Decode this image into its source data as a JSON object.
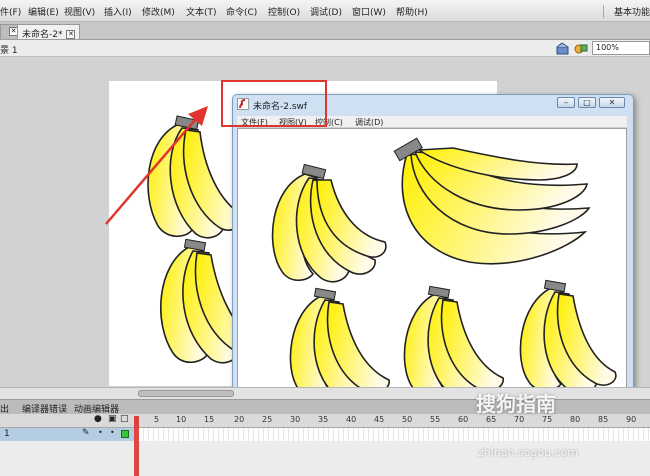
{
  "menu": {
    "items": [
      "件(F)",
      "编辑(E)",
      "视图(V)",
      "插入(I)",
      "修改(M)",
      "文本(T)",
      "命令(C)",
      "控制(O)",
      "调试(D)",
      "窗口(W)",
      "帮助(H)"
    ],
    "workspace_label": "基本功能"
  },
  "doc_tabs": {
    "first_tab": "",
    "active_tab": "未命名-2*"
  },
  "editbar": {
    "scene_label": "景 1",
    "zoom": "100%"
  },
  "swf_window": {
    "title": "未命名-2.swf",
    "menu": [
      "文件(F)",
      "视图(V)",
      "控制(C)",
      "调试(D)"
    ],
    "min_glyph": "–",
    "max_glyph": "□",
    "close_glyph": "✕"
  },
  "timeline": {
    "panel_tabs": [
      "出",
      "编译器错误",
      "动画编辑器"
    ],
    "layer_number": "1",
    "frame_numbers": [
      "5",
      "10",
      "15",
      "20",
      "25",
      "30",
      "35",
      "40",
      "45",
      "50",
      "55",
      "60",
      "65",
      "70",
      "75",
      "80",
      "85",
      "90"
    ],
    "current_frame": "1"
  },
  "watermark": {
    "brand": "搜狗指南",
    "url": "zhinan.sogou.com"
  },
  "colors": {
    "annotation_red": "#e0342f",
    "banana_yellow": "#ffef00",
    "stage_bg": "#ffffff"
  }
}
